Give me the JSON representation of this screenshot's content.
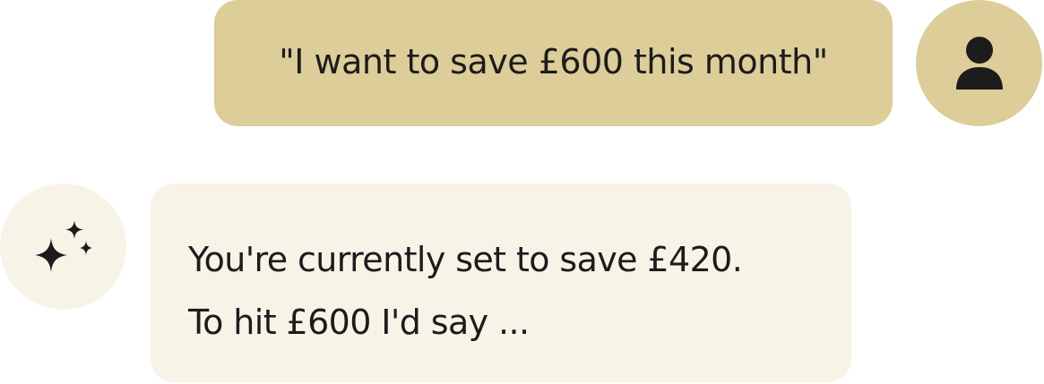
{
  "conversation": {
    "user_message": {
      "text": "\"I want to save £600 this month\"",
      "avatar_icon": "person-icon",
      "bubble_color": "#ddcd98"
    },
    "assistant_message": {
      "lines": [
        "You're currently set to save £420.",
        "To hit £600 I'd say ..."
      ],
      "avatar_icon": "sparkles-icon",
      "bubble_color": "#f7f3e7"
    }
  }
}
